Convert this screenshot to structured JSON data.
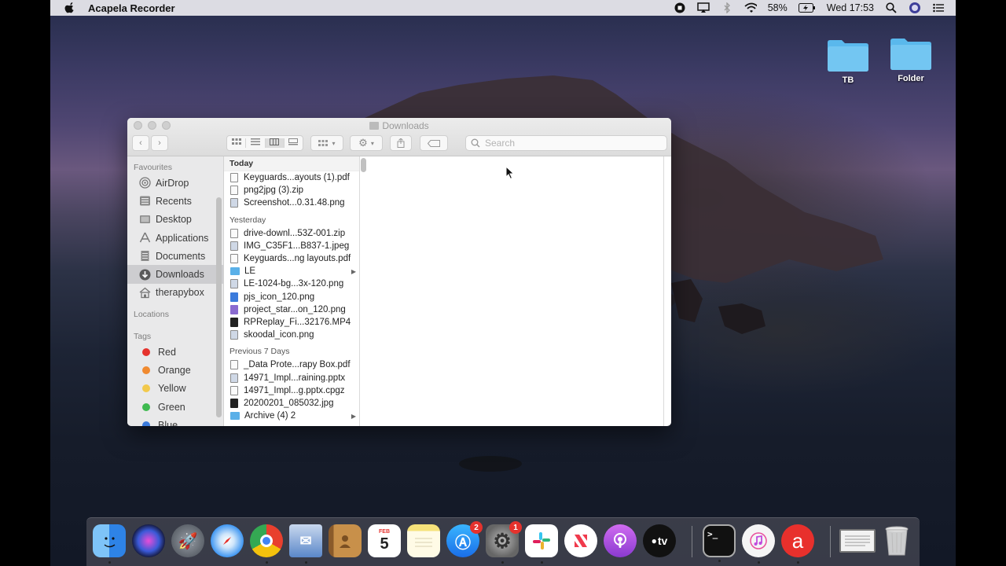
{
  "menubar": {
    "app_name": "Acapela Recorder",
    "battery": "58%",
    "clock": "Wed 17:53"
  },
  "desktop": {
    "icons": [
      {
        "label": "TB"
      },
      {
        "label": "Folder"
      }
    ]
  },
  "finder": {
    "title": "Downloads",
    "search_placeholder": "Search",
    "sidebar": {
      "favourites_heading": "Favourites",
      "items": [
        {
          "label": "AirDrop",
          "icon": "airdrop-icon"
        },
        {
          "label": "Recents",
          "icon": "recents-icon"
        },
        {
          "label": "Desktop",
          "icon": "desktop-icon"
        },
        {
          "label": "Applications",
          "icon": "applications-icon"
        },
        {
          "label": "Documents",
          "icon": "documents-icon"
        },
        {
          "label": "Downloads",
          "icon": "downloads-icon",
          "selected": true
        },
        {
          "label": "therapybox",
          "icon": "home-icon"
        }
      ],
      "locations_heading": "Locations",
      "tags_heading": "Tags",
      "tags": [
        {
          "label": "Red",
          "color": "#e5322d"
        },
        {
          "label": "Orange",
          "color": "#f08a30"
        },
        {
          "label": "Yellow",
          "color": "#f2c94c"
        },
        {
          "label": "Green",
          "color": "#3fba50"
        },
        {
          "label": "Blue",
          "color": "#3b7bdc"
        }
      ]
    },
    "groups": [
      {
        "label": "Today",
        "files": [
          {
            "name": "Keyguards...ayouts (1).pdf",
            "kind": "doc"
          },
          {
            "name": "png2jpg (3).zip",
            "kind": "doc"
          },
          {
            "name": "Screenshot...0.31.48.png",
            "kind": "img"
          }
        ]
      },
      {
        "label": "Yesterday",
        "files": [
          {
            "name": "drive-downl...53Z-001.zip",
            "kind": "doc"
          },
          {
            "name": "IMG_C35F1...B837-1.jpeg",
            "kind": "img"
          },
          {
            "name": "Keyguards...ng layouts.pdf",
            "kind": "doc"
          },
          {
            "name": "LE",
            "kind": "folder"
          },
          {
            "name": "LE-1024-bg...3x-120.png",
            "kind": "img"
          },
          {
            "name": "pjs_icon_120.png",
            "kind": "blue"
          },
          {
            "name": "project_star...on_120.png",
            "kind": "purple"
          },
          {
            "name": "RPReplay_Fi...32176.MP4",
            "kind": "dark"
          },
          {
            "name": "skoodal_icon.png",
            "kind": "img"
          }
        ]
      },
      {
        "label": "Previous 7 Days",
        "files": [
          {
            "name": "_Data Prote...rapy Box.pdf",
            "kind": "doc"
          },
          {
            "name": "14971_Impl...raining.pptx",
            "kind": "img"
          },
          {
            "name": "14971_Impl...g.pptx.cpgz",
            "kind": "doc"
          },
          {
            "name": "20200201_085032.jpg",
            "kind": "dark"
          },
          {
            "name": "Archive (4) 2",
            "kind": "folder"
          }
        ]
      }
    ]
  },
  "dock": {
    "apps": [
      {
        "name": "finder-icon",
        "color": "#3b8be8"
      },
      {
        "name": "siri-icon",
        "color": "#2a2a4a"
      },
      {
        "name": "launchpad-icon",
        "color": "#7a8088"
      },
      {
        "name": "safari-icon",
        "color": "#2d8cf0"
      },
      {
        "name": "chrome-icon",
        "color": "#e8e8e8"
      },
      {
        "name": "mail-icon",
        "color": "#5a87c9"
      },
      {
        "name": "contacts-icon",
        "color": "#b07a3a"
      },
      {
        "name": "calendar-icon",
        "color": "#ffffff",
        "text": "5"
      },
      {
        "name": "notes-icon",
        "color": "#f6e27a"
      },
      {
        "name": "app-store-icon",
        "color": "#2e8cf0",
        "badge": "2"
      },
      {
        "name": "system-preferences-icon",
        "color": "#8c8c8c",
        "badge": "1"
      },
      {
        "name": "slack-icon",
        "color": "#ffffff"
      },
      {
        "name": "news-icon",
        "color": "#f03a4c"
      },
      {
        "name": "podcasts-icon",
        "color": "#9b4dd8"
      },
      {
        "name": "apple-tv-icon",
        "color": "#111111",
        "text": "tv"
      },
      {
        "name": "terminal-icon",
        "color": "#111111",
        "text": ">_"
      },
      {
        "name": "itunes-icon",
        "color": "#f5f5f5"
      },
      {
        "name": "acapela-icon",
        "color": "#e8302c",
        "text": "a"
      },
      {
        "name": "screenshot-preview-icon",
        "color": "#dcdcdc"
      },
      {
        "name": "trash-icon",
        "color": "#c9c9c9"
      }
    ]
  }
}
